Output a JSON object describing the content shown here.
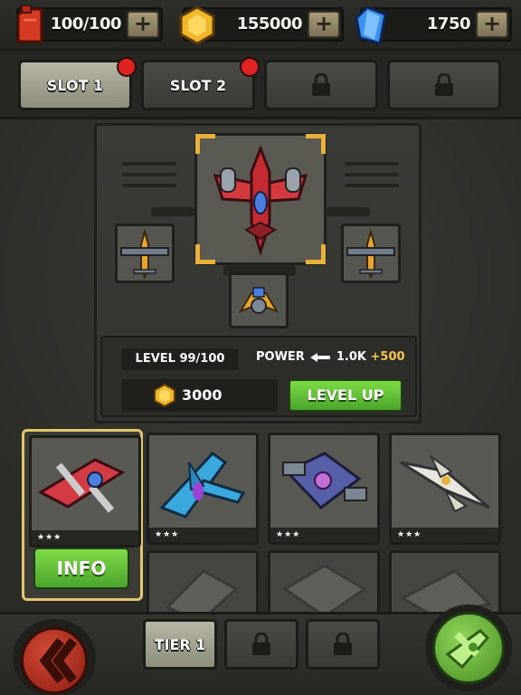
{
  "resources": {
    "fuel": {
      "value": "100/100",
      "icon": "fuel-can-icon"
    },
    "gold": {
      "value": "155000",
      "icon": "gold-coin-icon"
    },
    "gems": {
      "value": "1750",
      "icon": "blue-crystal-icon"
    },
    "plus": "+"
  },
  "slots": [
    {
      "label": "SLOT 1",
      "state": "active",
      "badge": true
    },
    {
      "label": "SLOT 2",
      "state": "normal",
      "badge": true
    },
    {
      "label": "",
      "state": "locked",
      "badge": false
    },
    {
      "label": "",
      "state": "locked",
      "badge": false
    }
  ],
  "stats": {
    "level": "LEVEL 99/100",
    "power_label": "POWER",
    "power_value": "1.0K",
    "power_bonus": "+500",
    "upgrade_cost": "3000",
    "level_up_label": "LEVEL UP"
  },
  "planes": [
    {
      "stars": "★★★",
      "color": "#c8333a",
      "selected": true
    },
    {
      "stars": "★★★",
      "color": "#3aa7dd"
    },
    {
      "stars": "★★★",
      "color": "#5560a8"
    },
    {
      "stars": "★★★",
      "color": "#e6e6df"
    }
  ],
  "info_label": "INFO",
  "tiers": [
    {
      "label": "TIER 1",
      "state": "active"
    },
    {
      "label": "",
      "state": "locked"
    },
    {
      "label": "",
      "state": "locked"
    }
  ],
  "colors": {
    "accent_green": "#5cbb33",
    "accent_gold": "#e8b13a",
    "badge_red": "#e02320"
  }
}
